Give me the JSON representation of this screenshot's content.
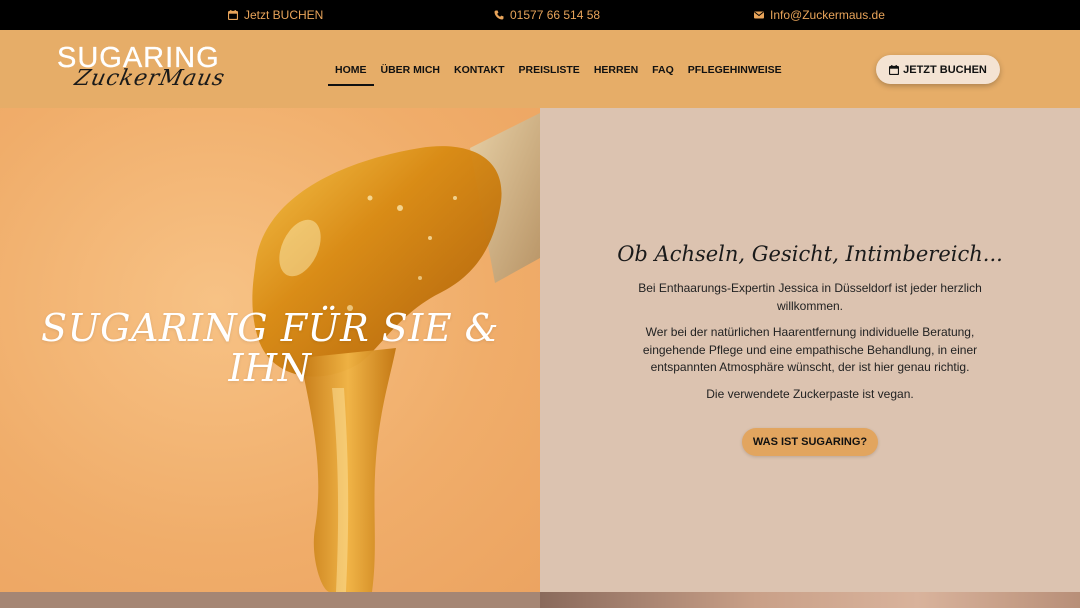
{
  "topbar": {
    "book_label": "Jetzt BUCHEN",
    "phone": "01577 66 514 58",
    "email": "Info@Zuckermaus.de"
  },
  "logo": {
    "main": "SUGARING",
    "script": "ZuckerMaus"
  },
  "nav": {
    "items": [
      {
        "label": "HOME",
        "active": true
      },
      {
        "label": "ÜBER MICH",
        "active": false
      },
      {
        "label": "KONTAKT",
        "active": false
      },
      {
        "label": "PREISLISTE",
        "active": false
      },
      {
        "label": "HERREN",
        "active": false
      },
      {
        "label": "FAQ",
        "active": false
      },
      {
        "label": "PFLEGEHINWEISE",
        "active": false
      }
    ],
    "cta_label": "JETZT BUCHEN"
  },
  "hero": {
    "title": "SUGARING FÜR SIE & IHN",
    "heading": "Ob Achseln, Gesicht, Intimbereich...",
    "paragraphs": [
      "Bei Enthaarungs-Expertin Jessica in Düsseldorf ist jeder herzlich willkommen.",
      "Wer bei der natürlichen Haarentfernung individuelle Beratung, eingehende Pflege und eine empathische Behandlung, in einer entspannten Atmosphäre wünscht, der ist hier genau richtig.",
      "Die verwendete Zuckerpaste ist vegan."
    ],
    "button_label": "WAS IST SUGARING?"
  },
  "colors": {
    "topbar_bg": "#000000",
    "accent": "#e8a45a",
    "header_bg": "#e6ad68",
    "hero_right_bg": "#dcc3b0"
  }
}
